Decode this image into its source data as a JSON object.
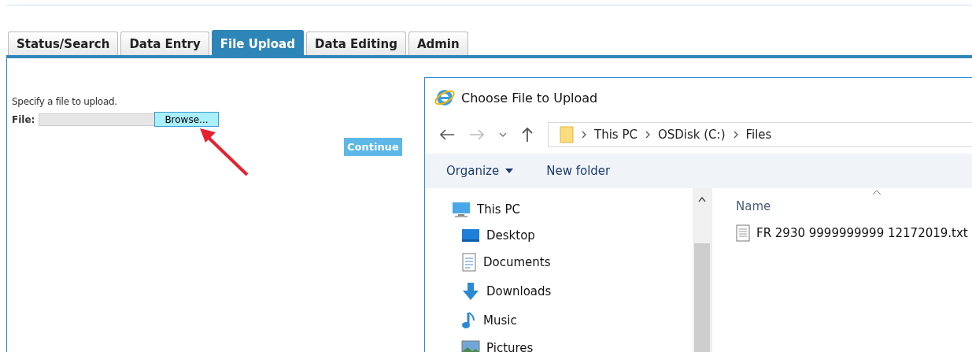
{
  "tabs": [
    {
      "label": "Status/Search",
      "selected": false
    },
    {
      "label": "Data Entry",
      "selected": false
    },
    {
      "label": "File Upload",
      "selected": true
    },
    {
      "label": "Data Editing",
      "selected": false
    },
    {
      "label": "Admin",
      "selected": false
    }
  ],
  "upload_form": {
    "instruction": "Specify a file to upload.",
    "file_label": "File:",
    "browse_button": "Browse...",
    "continue_button": "Continue"
  },
  "dialog": {
    "title": "Choose File to Upload",
    "breadcrumbs": [
      "This PC",
      "OSDisk (C:)",
      "Files"
    ],
    "toolbar": {
      "organize": "Organize",
      "new_folder": "New folder"
    },
    "nav_tree": [
      {
        "label": "This PC",
        "kind": "pc",
        "children": [
          {
            "label": "Desktop",
            "kind": "desktop"
          },
          {
            "label": "Documents",
            "kind": "documents"
          },
          {
            "label": "Downloads",
            "kind": "downloads"
          },
          {
            "label": "Music",
            "kind": "music"
          },
          {
            "label": "Pictures",
            "kind": "pictures"
          }
        ]
      }
    ],
    "columns": [
      "Name"
    ],
    "files": [
      {
        "name": "FR 2930 9999999999 12172019.txt"
      }
    ]
  }
}
